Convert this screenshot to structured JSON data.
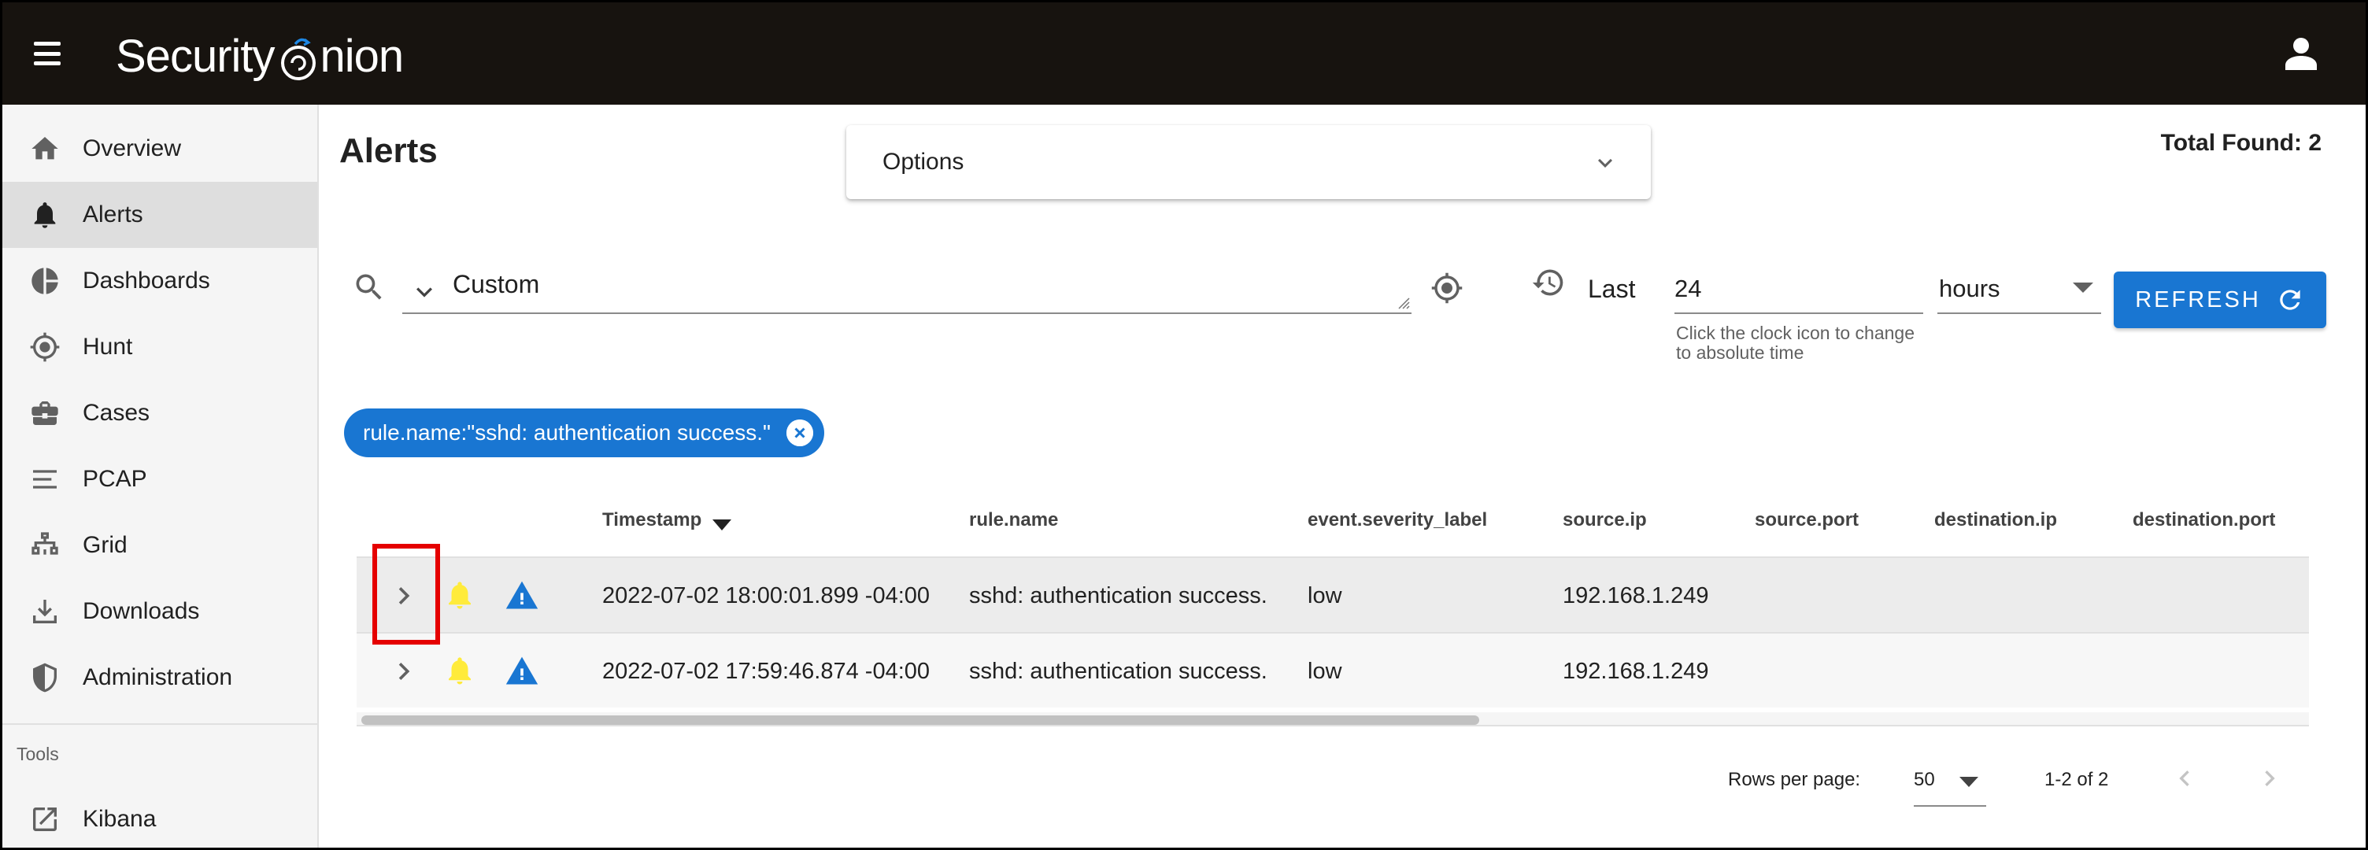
{
  "app": {
    "logo_text_left": "Security",
    "logo_text_right": "nion",
    "colors": {
      "appbar": "#17130f",
      "primary": "#1976d2",
      "bell": "#ffeb3b",
      "highlight_box": "#e50000"
    }
  },
  "sidebar": {
    "items": [
      {
        "label": "Overview",
        "icon": "home-icon"
      },
      {
        "label": "Alerts",
        "icon": "bell-icon",
        "active": true
      },
      {
        "label": "Dashboards",
        "icon": "pie-chart-icon"
      },
      {
        "label": "Hunt",
        "icon": "crosshair-icon"
      },
      {
        "label": "Cases",
        "icon": "briefcase-icon"
      },
      {
        "label": "PCAP",
        "icon": "list-lines-icon"
      },
      {
        "label": "Grid",
        "icon": "network-grid-icon"
      },
      {
        "label": "Downloads",
        "icon": "download-icon"
      },
      {
        "label": "Administration",
        "icon": "shield-icon"
      }
    ],
    "tools_heading": "Tools",
    "tools": [
      {
        "label": "Kibana",
        "icon": "external-link-icon"
      }
    ]
  },
  "main": {
    "title": "Alerts",
    "total_found": "Total Found: 2",
    "options_label": "Options",
    "query_value": "Custom",
    "time": {
      "last_label": "Last",
      "value": "24",
      "unit": "hours",
      "hint": "Click the clock icon to change to absolute time"
    },
    "refresh_label": "REFRESH",
    "filter_chip": "rule.name:\"sshd: authentication success.\""
  },
  "table": {
    "columns": [
      "Timestamp",
      "rule.name",
      "event.severity_label",
      "source.ip",
      "source.port",
      "destination.ip",
      "destination.port"
    ],
    "sorted_column": "Timestamp",
    "sort_direction": "descending",
    "rows": [
      {
        "timestamp": "2022-07-02 18:00:01.899 -04:00",
        "rule_name": "sshd: authentication success.",
        "severity": "low",
        "source_ip": "192.168.1.249",
        "source_port": "",
        "destination_ip": "",
        "destination_port": ""
      },
      {
        "timestamp": "2022-07-02 17:59:46.874 -04:00",
        "rule_name": "sshd: authentication success.",
        "severity": "low",
        "source_ip": "192.168.1.249",
        "source_port": "",
        "destination_ip": "",
        "destination_port": ""
      }
    ]
  },
  "pagination": {
    "rows_per_page_label": "Rows per page:",
    "rows_per_page": "50",
    "range": "1-2 of 2"
  }
}
